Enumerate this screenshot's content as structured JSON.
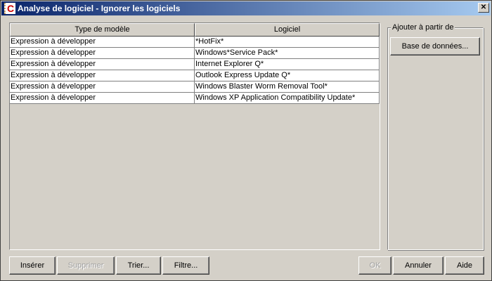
{
  "window": {
    "title": "Analyse de logiciel - Ignorer les logiciels",
    "app_icon": "C",
    "close": "✕"
  },
  "table": {
    "headers": [
      "Type de modèle",
      "Logiciel"
    ],
    "rows": [
      [
        "Expression à développer",
        "*HotFix*"
      ],
      [
        "Expression à développer",
        "Windows*Service Pack*"
      ],
      [
        "Expression à développer",
        "Internet Explorer Q*"
      ],
      [
        "Expression à développer",
        "Outlook Express Update Q*"
      ],
      [
        "Expression à développer",
        "Windows Blaster Worm Removal Tool*"
      ],
      [
        "Expression à développer",
        "Windows XP Application Compatibility Update*"
      ]
    ]
  },
  "group": {
    "label": "Ajouter à partir de",
    "button": "Base de données..."
  },
  "buttons": {
    "insert": "Insérer",
    "delete": "Supprimer",
    "sort": "Trier...",
    "filter": "Filtre...",
    "ok": "OK",
    "cancel": "Annuler",
    "help": "Aide"
  }
}
